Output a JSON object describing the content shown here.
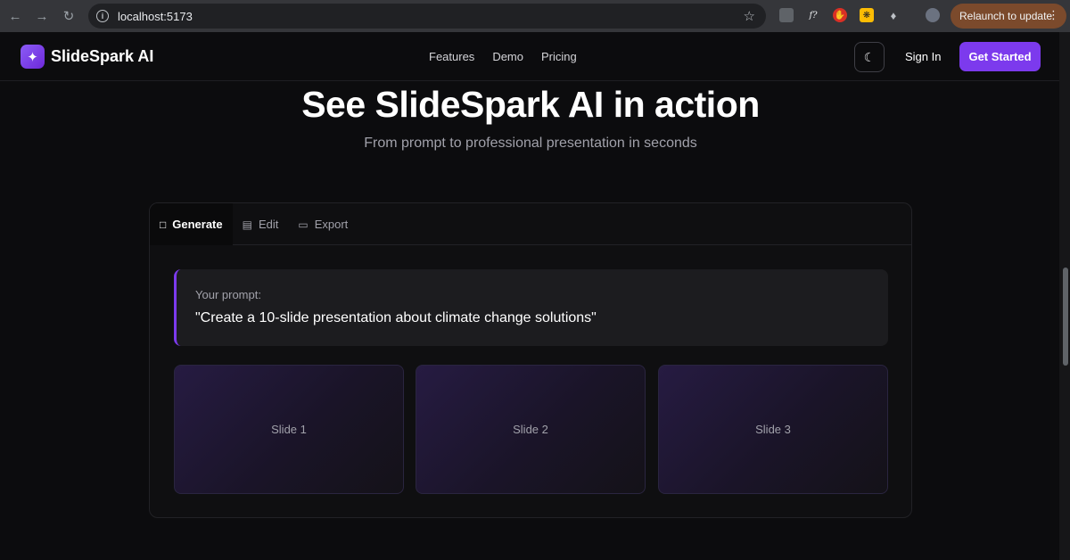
{
  "browser": {
    "url": "localhost:5173",
    "relaunch_label": "Relaunch to update"
  },
  "header": {
    "brand": "SlideSpark AI",
    "nav": [
      "Features",
      "Demo",
      "Pricing"
    ],
    "sign_in": "Sign In",
    "get_started": "Get Started"
  },
  "hero": {
    "title": "See SlideSpark AI in action",
    "subtitle": "From prompt to professional presentation in seconds"
  },
  "demo": {
    "tabs": [
      {
        "label": "Generate",
        "icon": "chat-icon",
        "active": true
      },
      {
        "label": "Edit",
        "icon": "document-icon",
        "active": false
      },
      {
        "label": "Export",
        "icon": "monitor-icon",
        "active": false
      }
    ],
    "prompt_label": "Your prompt:",
    "prompt_text": "\"Create a 10-slide presentation about climate change solutions\"",
    "slides": [
      "Slide 1",
      "Slide 2",
      "Slide 3"
    ]
  },
  "colors": {
    "accent": "#7c3aed",
    "background": "#0c0c0e"
  }
}
